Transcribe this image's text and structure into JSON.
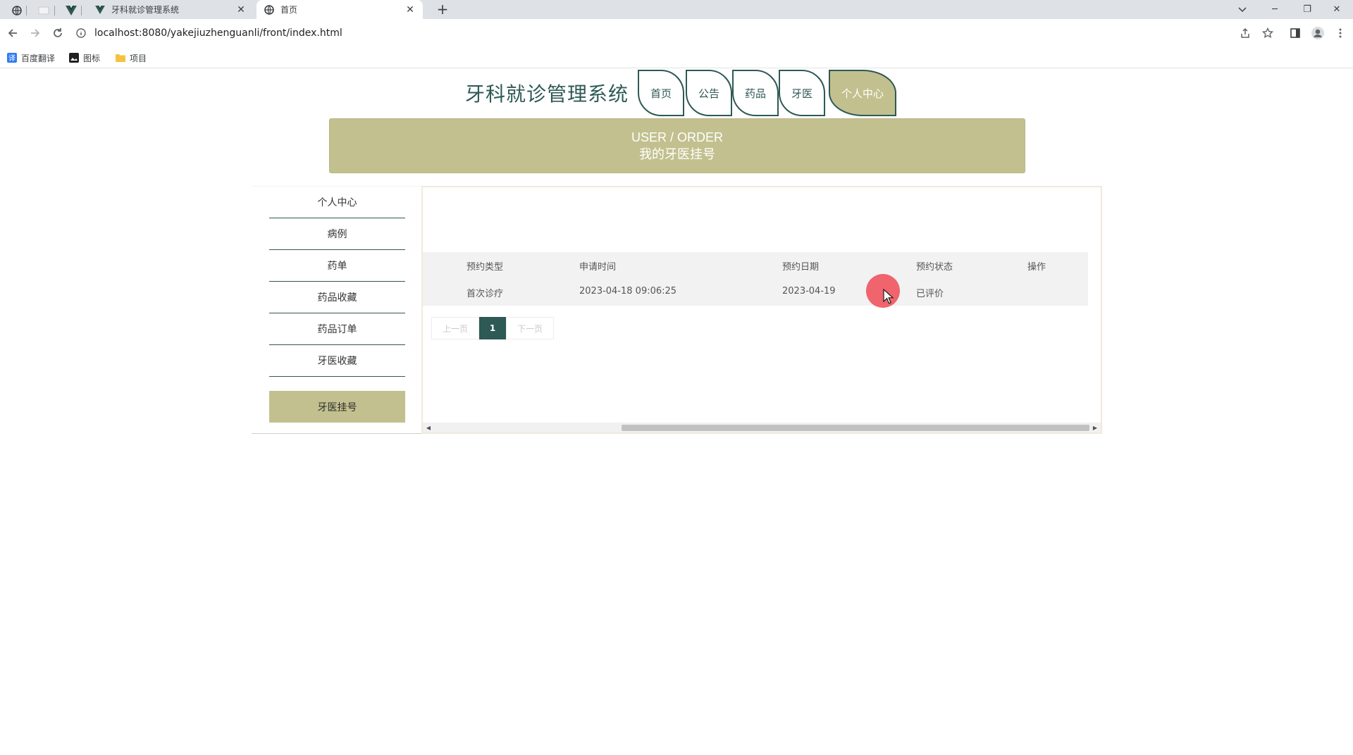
{
  "browser": {
    "tabs": [
      {
        "title": "牙科就诊管理系统",
        "close": "✕",
        "active": false
      },
      {
        "title": "首页",
        "close": "✕",
        "active": true
      }
    ],
    "new_tab": "+",
    "window_controls": {
      "minimize": "─",
      "restore": "❐",
      "close": "✕"
    },
    "url": "localhost:8080/yakejiuzhenguanli/front/index.html",
    "bookmarks": [
      {
        "label": "百度翻译",
        "icon": "translate-icon"
      },
      {
        "label": "图标",
        "icon": "image-icon"
      },
      {
        "label": "项目",
        "icon": "folder-icon"
      }
    ]
  },
  "site": {
    "title": "牙科就诊管理系统",
    "nav": [
      "首页",
      "公告",
      "药品",
      "牙医",
      "个人中心"
    ],
    "active_nav": "个人中心"
  },
  "banner": {
    "en": "USER / ORDER",
    "cn": "我的牙医挂号"
  },
  "sidebar": {
    "items": [
      "个人中心",
      "病例",
      "药单",
      "药品收藏",
      "药品订单",
      "牙医收藏",
      "牙医挂号"
    ],
    "active": "牙医挂号"
  },
  "table": {
    "headers": [
      "预约类型",
      "申请时间",
      "预约日期",
      "预约状态",
      "操作"
    ],
    "rows": [
      [
        "首次诊疗",
        "2023-04-18 09:06:25",
        "2023-04-19",
        "已评价",
        ""
      ]
    ]
  },
  "pagination": {
    "prev": "上一页",
    "current": "1",
    "next": "下一页"
  },
  "colors": {
    "primary": "#2e5955",
    "accent": "#c2c08e",
    "cursor_highlight": "#ef444f"
  }
}
